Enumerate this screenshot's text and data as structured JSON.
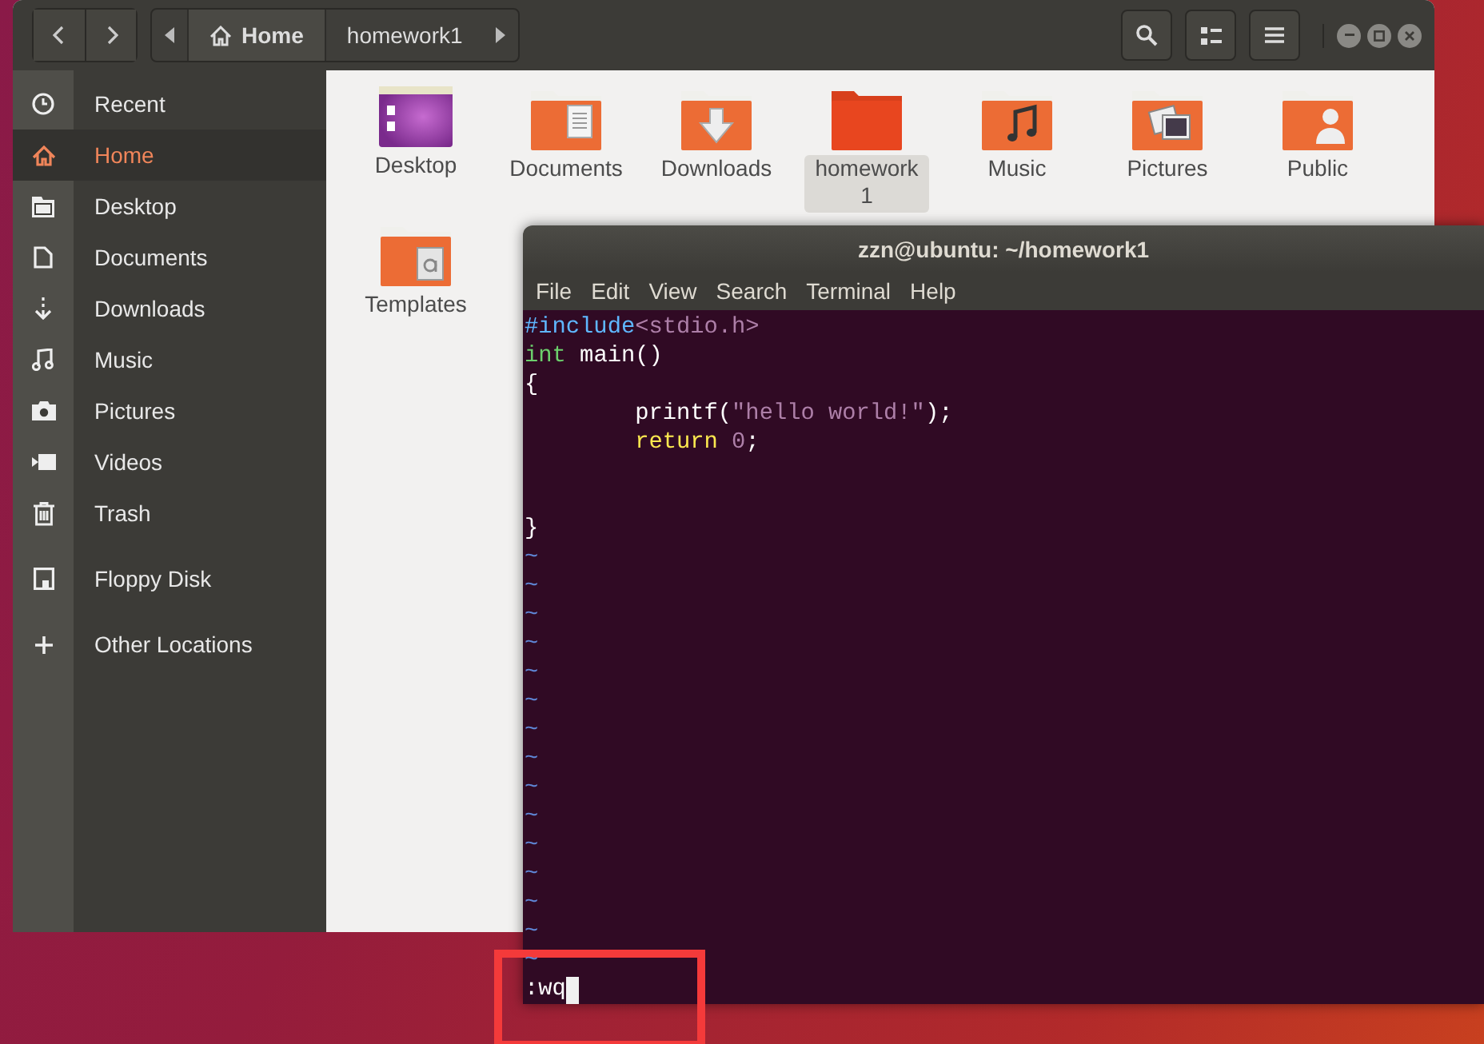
{
  "files_window": {
    "header": {
      "path": [
        {
          "label": "Home",
          "kind": "home",
          "selected": true
        },
        {
          "label": "homework1",
          "kind": "folder",
          "selected": false
        }
      ]
    },
    "sidebar": {
      "sections": [
        {
          "items": [
            {
              "label": "Recent",
              "kind": "clock",
              "selected": false
            },
            {
              "label": "Home",
              "kind": "home",
              "selected": true
            },
            {
              "label": "Desktop",
              "kind": "desktop",
              "selected": false
            },
            {
              "label": "Documents",
              "kind": "document",
              "selected": false
            },
            {
              "label": "Downloads",
              "kind": "download",
              "selected": false
            },
            {
              "label": "Music",
              "kind": "music",
              "selected": false
            },
            {
              "label": "Pictures",
              "kind": "camera",
              "selected": false
            },
            {
              "label": "Videos",
              "kind": "video",
              "selected": false
            },
            {
              "label": "Trash",
              "kind": "trash",
              "selected": false
            }
          ]
        },
        {
          "items": [
            {
              "label": "Floppy Disk",
              "kind": "floppy",
              "selected": false
            }
          ]
        },
        {
          "items": [
            {
              "label": "Other Locations",
              "kind": "plus",
              "selected": false
            }
          ]
        }
      ]
    },
    "items": [
      {
        "label": "Desktop",
        "kind": "desktop",
        "selected": false
      },
      {
        "label": "Documents",
        "kind": "documents",
        "selected": false
      },
      {
        "label": "Downloads",
        "kind": "downloads",
        "selected": false
      },
      {
        "label": "homework1",
        "kind": "plain",
        "selected": true
      },
      {
        "label": "Music",
        "kind": "music",
        "selected": false
      },
      {
        "label": "Pictures",
        "kind": "pictures",
        "selected": false
      },
      {
        "label": "Public",
        "kind": "public",
        "selected": false
      },
      {
        "label": "Templates",
        "kind": "templates",
        "selected": false
      }
    ]
  },
  "terminal": {
    "title": "zzn@ubuntu: ~/homework1",
    "menu": [
      "File",
      "Edit",
      "View",
      "Search",
      "Terminal",
      "Help"
    ],
    "code_lines": [
      {
        "kind": "code",
        "segments": [
          {
            "text": "#include",
            "kind": "preproc"
          },
          {
            "text": "<stdio.h>",
            "kind": "string"
          }
        ]
      },
      {
        "kind": "code",
        "segments": [
          {
            "text": "int",
            "kind": "type"
          },
          {
            "text": " main()",
            "kind": "plain"
          }
        ]
      },
      {
        "kind": "code",
        "segments": [
          {
            "text": "{",
            "kind": "plain"
          }
        ]
      },
      {
        "kind": "code",
        "segments": [
          {
            "text": "        printf(",
            "kind": "plain"
          },
          {
            "text": "\"hello world!\"",
            "kind": "string"
          },
          {
            "text": ");",
            "kind": "plain"
          }
        ]
      },
      {
        "kind": "code",
        "segments": [
          {
            "text": "        return",
            "kind": "keyword"
          },
          {
            "text": " 0",
            "kind": "string"
          },
          {
            "text": ";",
            "kind": "plain"
          }
        ]
      },
      {
        "kind": "blank"
      },
      {
        "kind": "blank"
      },
      {
        "kind": "code",
        "segments": [
          {
            "text": "}",
            "kind": "plain"
          }
        ]
      }
    ],
    "tilde_lines": [
      "~",
      "~",
      "~",
      "~",
      "~",
      "~",
      "~",
      "~",
      "~",
      "~",
      "~",
      "~",
      "~",
      "~",
      "~"
    ],
    "command_line": ":wq"
  }
}
